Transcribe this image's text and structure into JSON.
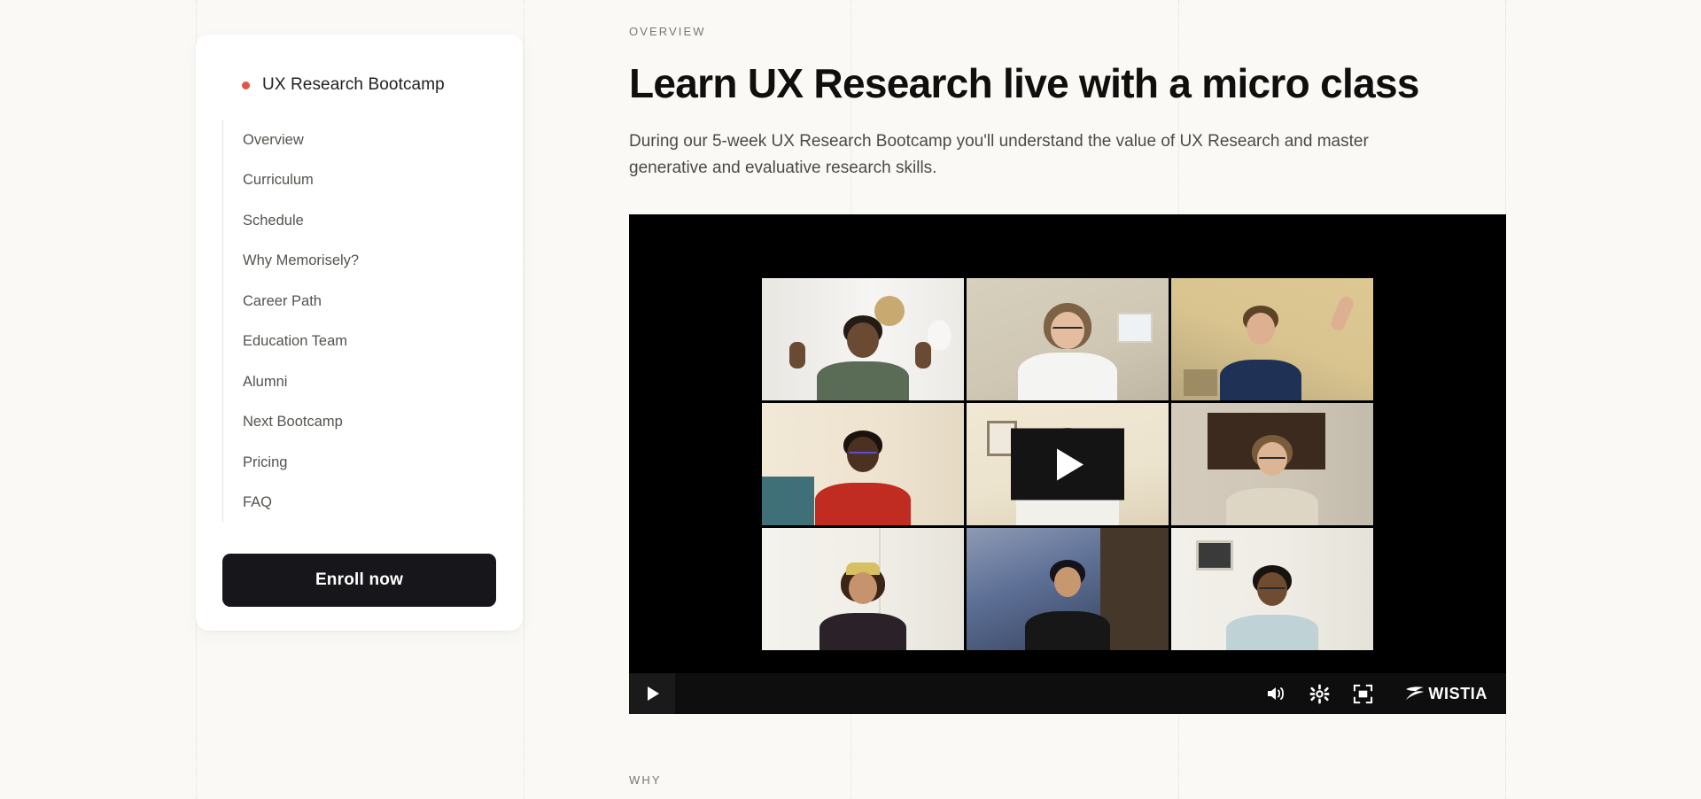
{
  "background": {
    "page_color": "#faf9f6",
    "guide_line_color": "#e2e0da"
  },
  "sidebar": {
    "title": "UX Research Bootcamp",
    "accent_color": "#e05744",
    "items": [
      {
        "label": "Overview"
      },
      {
        "label": "Curriculum"
      },
      {
        "label": "Schedule"
      },
      {
        "label": "Why Memorisely?"
      },
      {
        "label": "Career Path"
      },
      {
        "label": "Education Team"
      },
      {
        "label": "Alumni"
      },
      {
        "label": "Next Bootcamp"
      },
      {
        "label": "Pricing"
      },
      {
        "label": "FAQ"
      }
    ],
    "cta": {
      "label": "Enroll now",
      "background_color": "#17161a",
      "text_color": "#ffffff"
    }
  },
  "main": {
    "eyebrow": "OVERVIEW",
    "headline": "Learn UX Research live with a micro class",
    "subhead": "During our 5-week UX Research Bootcamp you'll understand the value of UX Research and master generative and evaluative research skills.",
    "next_section_eyebrow": "WHY"
  },
  "video": {
    "provider": "WISTIA",
    "background_color": "#000000",
    "controls": {
      "play_icon": "play-icon",
      "volume_icon": "volume-icon",
      "settings_icon": "gear-icon",
      "fullscreen_icon": "fullscreen-icon"
    },
    "center_play_icon": "play-icon",
    "grid": {
      "rows": 3,
      "columns": 3,
      "tiles": [
        {
          "id": "tile-1",
          "wall": "#f3f2ef",
          "skin": "#6b4a33",
          "shirt": "#5a6b56",
          "hair": "#241b14",
          "accent": "#e8e6e1"
        },
        {
          "id": "tile-2",
          "wall": "#cfc7b4",
          "skin": "#e4bda0",
          "shirt": "#f4f4f2",
          "hair": "#7d6245",
          "accent": "#eaf0f3"
        },
        {
          "id": "tile-3",
          "wall": "#d9c48f",
          "skin": "#dcb091",
          "shirt": "#1f3256",
          "hair": "#5c4226",
          "accent": "#b8a77e"
        },
        {
          "id": "tile-4",
          "wall": "#eee3cf",
          "skin": "#4c3121",
          "shirt": "#c02b22",
          "hair": "#1a120c",
          "accent": "#3f6f77"
        },
        {
          "id": "tile-5",
          "wall": "#ece3cd",
          "skin": "#e2bda1",
          "shirt": "#f2f0ea",
          "hair": "#6a533a",
          "accent": "#8d7f68"
        },
        {
          "id": "tile-6",
          "wall": "#cfc6b7",
          "skin": "#ddb595",
          "shirt": "#ded6c4",
          "hair": "#7a5c3c",
          "accent": "#3b2a1d"
        },
        {
          "id": "tile-7",
          "wall": "#f0eee7",
          "skin": "#c6936c",
          "shirt": "#2b2129",
          "hair": "#3a2516",
          "accent": "#d6c061"
        },
        {
          "id": "tile-8",
          "wall": "#2f3a50",
          "skin": "#c79870",
          "shirt": "#171718",
          "hair": "#14131a",
          "accent": "#5d6f96"
        },
        {
          "id": "tile-9",
          "wall": "#efece5",
          "skin": "#6f4b2f",
          "shirt": "#bfd2d6",
          "hair": "#191310",
          "accent": "#3a3a3a"
        }
      ]
    }
  }
}
